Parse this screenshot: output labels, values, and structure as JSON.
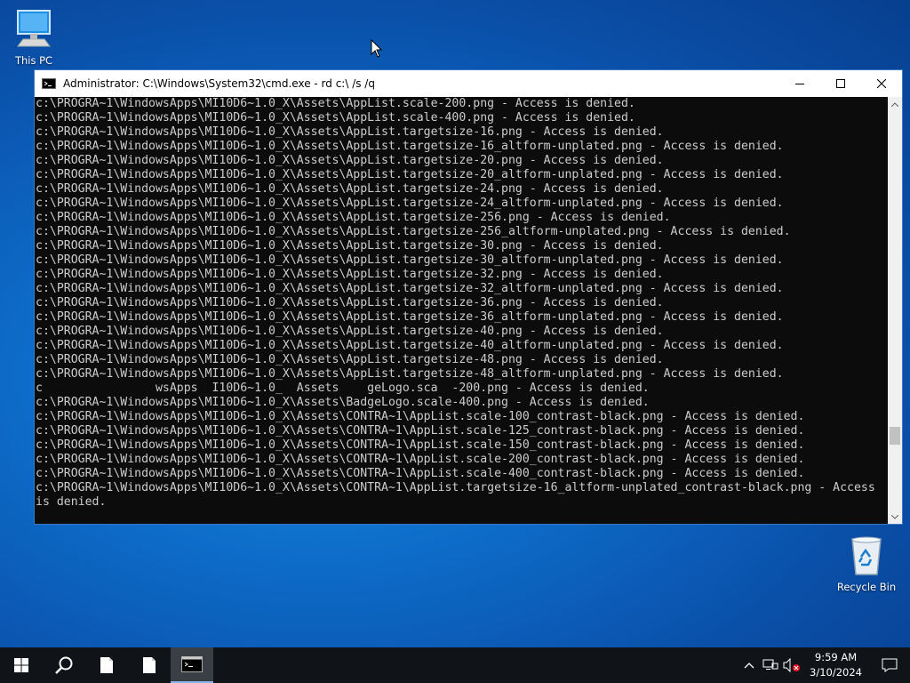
{
  "desktop": {
    "icons": [
      {
        "label": "This PC"
      },
      {
        "label": "Recycle Bin"
      }
    ]
  },
  "window": {
    "title": "Administrator: C:\\Windows\\System32\\cmd.exe - rd  c:\\ /s /q",
    "scroll_position": 0.83
  },
  "console": {
    "lines": [
      "c:\\PROGRA~1\\WindowsApps\\MI10D6~1.0_X\\Assets\\AppList.scale-200.png - Access is denied.",
      "c:\\PROGRA~1\\WindowsApps\\MI10D6~1.0_X\\Assets\\AppList.scale-400.png - Access is denied.",
      "c:\\PROGRA~1\\WindowsApps\\MI10D6~1.0_X\\Assets\\AppList.targetsize-16.png - Access is denied.",
      "c:\\PROGRA~1\\WindowsApps\\MI10D6~1.0_X\\Assets\\AppList.targetsize-16_altform-unplated.png - Access is denied.",
      "c:\\PROGRA~1\\WindowsApps\\MI10D6~1.0_X\\Assets\\AppList.targetsize-20.png - Access is denied.",
      "c:\\PROGRA~1\\WindowsApps\\MI10D6~1.0_X\\Assets\\AppList.targetsize-20_altform-unplated.png - Access is denied.",
      "c:\\PROGRA~1\\WindowsApps\\MI10D6~1.0_X\\Assets\\AppList.targetsize-24.png - Access is denied.",
      "c:\\PROGRA~1\\WindowsApps\\MI10D6~1.0_X\\Assets\\AppList.targetsize-24_altform-unplated.png - Access is denied.",
      "c:\\PROGRA~1\\WindowsApps\\MI10D6~1.0_X\\Assets\\AppList.targetsize-256.png - Access is denied.",
      "c:\\PROGRA~1\\WindowsApps\\MI10D6~1.0_X\\Assets\\AppList.targetsize-256_altform-unplated.png - Access is denied.",
      "c:\\PROGRA~1\\WindowsApps\\MI10D6~1.0_X\\Assets\\AppList.targetsize-30.png - Access is denied.",
      "c:\\PROGRA~1\\WindowsApps\\MI10D6~1.0_X\\Assets\\AppList.targetsize-30_altform-unplated.png - Access is denied.",
      "c:\\PROGRA~1\\WindowsApps\\MI10D6~1.0_X\\Assets\\AppList.targetsize-32.png - Access is denied.",
      "c:\\PROGRA~1\\WindowsApps\\MI10D6~1.0_X\\Assets\\AppList.targetsize-32_altform-unplated.png - Access is denied.",
      "c:\\PROGRA~1\\WindowsApps\\MI10D6~1.0_X\\Assets\\AppList.targetsize-36.png - Access is denied.",
      "c:\\PROGRA~1\\WindowsApps\\MI10D6~1.0_X\\Assets\\AppList.targetsize-36_altform-unplated.png - Access is denied.",
      "c:\\PROGRA~1\\WindowsApps\\MI10D6~1.0_X\\Assets\\AppList.targetsize-40.png - Access is denied.",
      "c:\\PROGRA~1\\WindowsApps\\MI10D6~1.0_X\\Assets\\AppList.targetsize-40_altform-unplated.png - Access is denied.",
      "c:\\PROGRA~1\\WindowsApps\\MI10D6~1.0_X\\Assets\\AppList.targetsize-48.png - Access is denied.",
      "c:\\PROGRA~1\\WindowsApps\\MI10D6~1.0_X\\Assets\\AppList.targetsize-48_altform-unplated.png - Access is denied.",
      "c                wsApps  I10D6~1.0_  Assets    geLogo.sca  -200.png - Access is denied.",
      "c:\\PROGRA~1\\WindowsApps\\MI10D6~1.0_X\\Assets\\BadgeLogo.scale-400.png - Access is denied.",
      "c:\\PROGRA~1\\WindowsApps\\MI10D6~1.0_X\\Assets\\CONTRA~1\\AppList.scale-100_contrast-black.png - Access is denied.",
      "c:\\PROGRA~1\\WindowsApps\\MI10D6~1.0_X\\Assets\\CONTRA~1\\AppList.scale-125_contrast-black.png - Access is denied.",
      "c:\\PROGRA~1\\WindowsApps\\MI10D6~1.0_X\\Assets\\CONTRA~1\\AppList.scale-150_contrast-black.png - Access is denied.",
      "c:\\PROGRA~1\\WindowsApps\\MI10D6~1.0_X\\Assets\\CONTRA~1\\AppList.scale-200_contrast-black.png - Access is denied.",
      "c:\\PROGRA~1\\WindowsApps\\MI10D6~1.0_X\\Assets\\CONTRA~1\\AppList.scale-400_contrast-black.png - Access is denied.",
      "c:\\PROGRA~1\\WindowsApps\\MI10D6~1.0_X\\Assets\\CONTRA~1\\AppList.targetsize-16_altform-unplated_contrast-black.png - Access",
      "is denied."
    ]
  },
  "taskbar": {
    "items": [
      "start-icon",
      "search-icon",
      "file-icon",
      "file-icon",
      "cmd-icon"
    ],
    "clock": {
      "time": "9:59 AM",
      "date": "3/10/2024"
    }
  },
  "colors": {
    "console_bg": "#0c0c0c",
    "console_fg": "#cccccc",
    "taskbar": "#101418"
  }
}
